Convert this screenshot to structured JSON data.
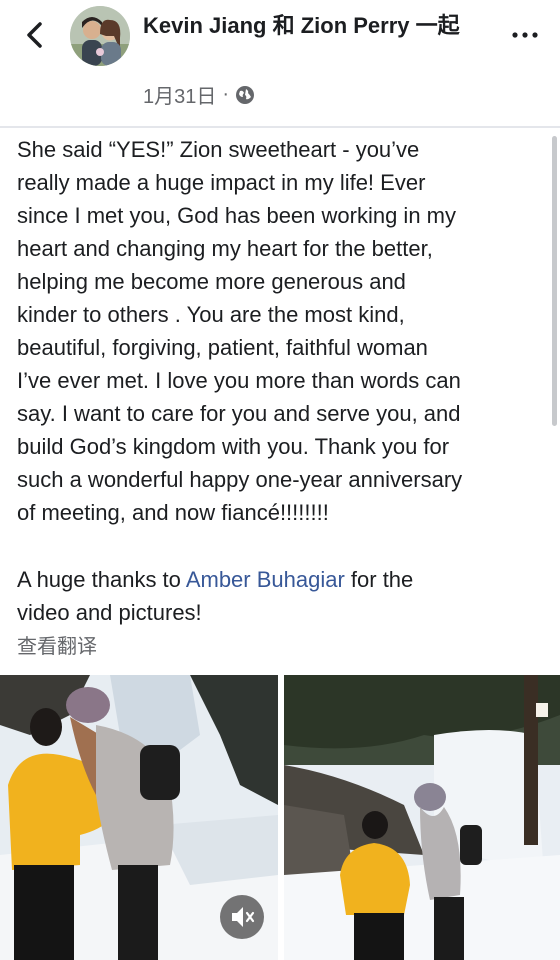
{
  "header": {
    "title": "Kevin Jiang 和 Zion Perry 一起",
    "date": "1月31日",
    "separator": "·"
  },
  "post": {
    "body": "She said “YES!” Zion sweetheart - you’ve\nreally made a huge impact in my life! Ever\nsince I met you, God has been working in my\nheart and changing my heart for the better,\nhelping me become more generous and\nkinder to others . You are the most kind,\nbeautiful, forgiving, patient, faithful woman\nI’ve ever met. I love you more than words can\nsay. I want to care for you and serve you, and\nbuild God’s kingdom with you. Thank you for\nsuch a wonderful happy one-year anniversary\nof meeting, and now fiancé!!!!!!!!",
    "thanks_prefix": "A huge thanks to ",
    "thanks_link": "Amber Buhagiar",
    "thanks_suffix": " for the\nvideo and pictures!",
    "translate_label": "查看翻译"
  },
  "colors": {
    "link": "#385898",
    "muted": "#65676b",
    "text": "#1c1e21"
  },
  "icons": {
    "back": "chevron-left-icon",
    "more": "more-dots-icon",
    "audience": "globe-icon",
    "mute": "speaker-muted-icon"
  }
}
